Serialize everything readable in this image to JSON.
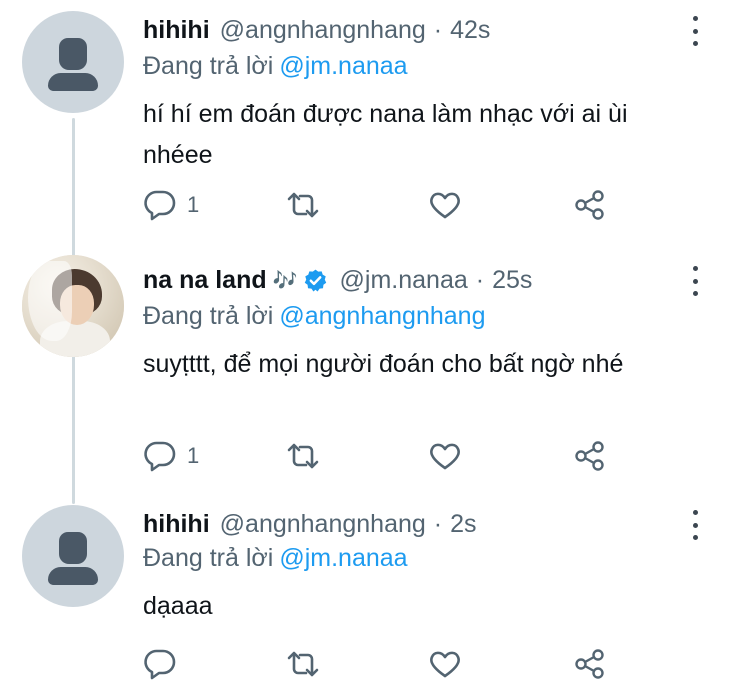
{
  "tweets": [
    {
      "name": "hihihi",
      "handle": "@angnhangnhang",
      "separator": "·",
      "time": "42s",
      "reply_prefix": "Đang trả lời",
      "reply_mention": "@jm.nanaa",
      "text": "hí hí em đoán được nana làm nhạc với ai ùi nhéee",
      "reply_count": "1",
      "avatar": "default-avatar-icon"
    },
    {
      "name": "na na land",
      "name_emoji": "🎶",
      "verified": true,
      "handle": "@jm.nanaa",
      "separator": "·",
      "time": "25s",
      "reply_prefix": "Đang trả lời",
      "reply_mention": "@angnhangnhang",
      "text": "suyṭttt, để mọi người đoán cho bất ngờ nhé",
      "reply_count": "1",
      "avatar": "profile-photo"
    },
    {
      "name": "hihihi",
      "handle": "@angnhangnhang",
      "separator": "·",
      "time": "2s",
      "reply_prefix": "Đang trả lời",
      "reply_mention": "@jm.nanaa",
      "text": "dạaaa",
      "reply_count": "",
      "avatar": "default-avatar-icon"
    }
  ],
  "colors": {
    "text": "#0f1419",
    "secondary": "#536471",
    "link": "#1d9bf0",
    "icon": "#536471",
    "thread_line": "#cfd9de"
  },
  "icons": {
    "reply": "reply-icon",
    "retweet": "retweet-icon",
    "like": "heart-icon",
    "share": "share-icon",
    "more": "more-vertical-icon",
    "verified": "verified-badge-icon"
  }
}
